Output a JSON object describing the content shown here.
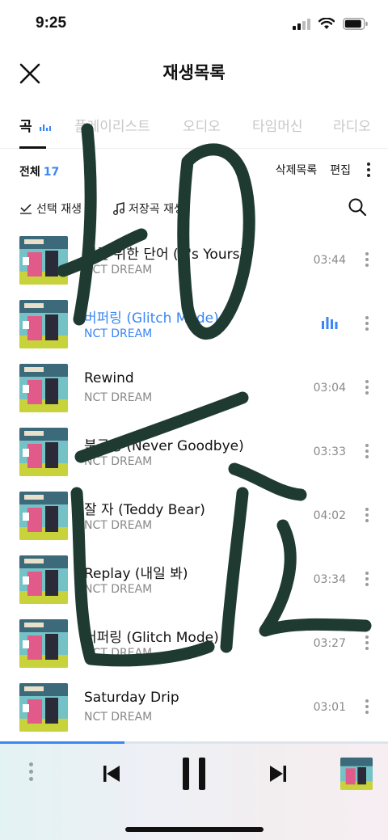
{
  "status_bar": {
    "time": "9:25"
  },
  "header": {
    "title": "재생목록",
    "close_icon": "close-icon"
  },
  "tabs": [
    {
      "label": "곡",
      "active": true
    },
    {
      "label": "플레이리스트",
      "active": false
    },
    {
      "label": "오디오",
      "active": false
    },
    {
      "label": "타임머신",
      "active": false
    },
    {
      "label": "라디오",
      "active": false
    }
  ],
  "toolbar": {
    "total_label": "전체",
    "total_count": "17",
    "saved_list_label": "삭제목록",
    "edit_label": "편집"
  },
  "subbar": {
    "select_play_label": "선택 재생",
    "saved_play_label": "저장곡 재생",
    "search_icon": "search-icon"
  },
  "tracks": [
    {
      "title": "너를 위한 단어 (It's Yours)",
      "artist": "NCT DREAM",
      "duration": "03:44",
      "playing": false
    },
    {
      "title": "버퍼링 (Glitch Mode)",
      "artist": "NCT DREAM",
      "duration": "",
      "playing": true
    },
    {
      "title": "Rewind",
      "artist": "NCT DREAM",
      "duration": "03:04",
      "playing": false
    },
    {
      "title": "북극성 (Never Goodbye)",
      "artist": "NCT DREAM",
      "duration": "03:33",
      "playing": false
    },
    {
      "title": "잘 자 (Teddy Bear)",
      "artist": "NCT DREAM",
      "duration": "04:02",
      "playing": false
    },
    {
      "title": "Replay (내일 봐)",
      "artist": "NCT DREAM",
      "duration": "03:34",
      "playing": false
    },
    {
      "title": "버퍼링 (Glitch Mode)",
      "artist": "NCT DREAM",
      "duration": "03:27",
      "playing": false
    },
    {
      "title": "Saturday Drip",
      "artist": "NCT DREAM",
      "duration": "03:01",
      "playing": false
    }
  ],
  "player": {
    "progress_fraction": 0.32
  },
  "colors": {
    "accent": "#3a86f5",
    "scribble": "#1f3b31"
  }
}
